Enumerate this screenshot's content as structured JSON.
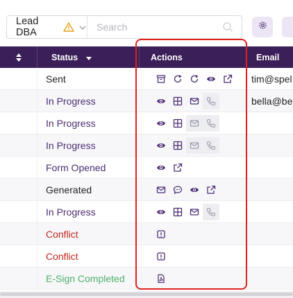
{
  "toolbar": {
    "filter_label": "Lead DBA",
    "search_placeholder": "Search"
  },
  "table": {
    "columns": {
      "status": "Status",
      "actions": "Actions",
      "email": "Email"
    },
    "rows": [
      {
        "status": "Sent",
        "status_type": "sent",
        "email": "tim@spel",
        "actions": [
          "archive",
          "refresh",
          "refresh",
          "eye",
          "external-link"
        ]
      },
      {
        "status": "In Progress",
        "status_type": "progress",
        "email": "bella@be",
        "actions": [
          "eye",
          "grid",
          "mail",
          "phone"
        ]
      },
      {
        "status": "In Progress",
        "status_type": "progress",
        "email": "",
        "actions": [
          "eye",
          "grid",
          "mail-muted",
          "phone"
        ]
      },
      {
        "status": "In Progress",
        "status_type": "progress",
        "email": "",
        "actions": [
          "eye",
          "grid",
          "mail-muted",
          "phone"
        ]
      },
      {
        "status": "Form Opened",
        "status_type": "opened",
        "email": "",
        "actions": [
          "eye",
          "external-link"
        ]
      },
      {
        "status": "Generated",
        "status_type": "generated",
        "email": "",
        "actions": [
          "mail",
          "chat",
          "eye",
          "external-link"
        ]
      },
      {
        "status": "In Progress",
        "status_type": "progress",
        "email": "",
        "actions": [
          "eye",
          "grid",
          "mail",
          "phone"
        ]
      },
      {
        "status": "Conflict",
        "status_type": "conflict",
        "email": "",
        "actions": [
          "alert"
        ]
      },
      {
        "status": "Conflict",
        "status_type": "conflict",
        "email": "",
        "actions": [
          "alert"
        ]
      },
      {
        "status": "E-Sign Completed",
        "status_type": "esign",
        "email": "",
        "actions": [
          "pdf"
        ]
      }
    ]
  },
  "colors": {
    "header_bg": "#3b1f58",
    "accent": "#4a2d73",
    "conflict": "#c0261d",
    "esign": "#4caf6a",
    "highlight": "#e0201f"
  }
}
